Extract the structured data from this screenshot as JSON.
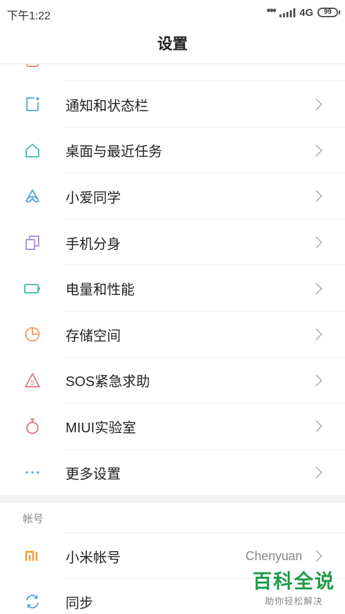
{
  "status_bar": {
    "time": "下午1:22",
    "network": "4G",
    "battery": "99"
  },
  "header": {
    "title": "设置"
  },
  "settings_items": [
    {
      "label": "通知和状态栏",
      "icon": "notification-icon",
      "color": "#4aa3df"
    },
    {
      "label": "桌面与最近任务",
      "icon": "home-icon",
      "color": "#3fb8a8"
    },
    {
      "label": "小爱同学",
      "icon": "assistant-icon",
      "color": "#4aa3df"
    },
    {
      "label": "手机分身",
      "icon": "second-space-icon",
      "color": "#a58ad6"
    },
    {
      "label": "电量和性能",
      "icon": "battery-icon",
      "color": "#3fb8a8"
    },
    {
      "label": "存储空间",
      "icon": "storage-icon",
      "color": "#f29a5a"
    },
    {
      "label": "SOS紧急求助",
      "icon": "sos-icon",
      "color": "#e0707a"
    },
    {
      "label": "MIUI实验室",
      "icon": "lab-icon",
      "color": "#e0707a"
    },
    {
      "label": "更多设置",
      "icon": "more-icon",
      "color": "#4aa3df"
    }
  ],
  "account_section": {
    "header": "帐号",
    "items": [
      {
        "label": "小米帐号",
        "value": "Chenyuan",
        "icon": "mi-logo-icon",
        "color": "#f29a2e"
      },
      {
        "label": "同步",
        "icon": "sync-icon",
        "color": "#4aa3df"
      }
    ]
  },
  "watermark": {
    "title": "百科全说",
    "subtitle": "助你轻松解决"
  }
}
